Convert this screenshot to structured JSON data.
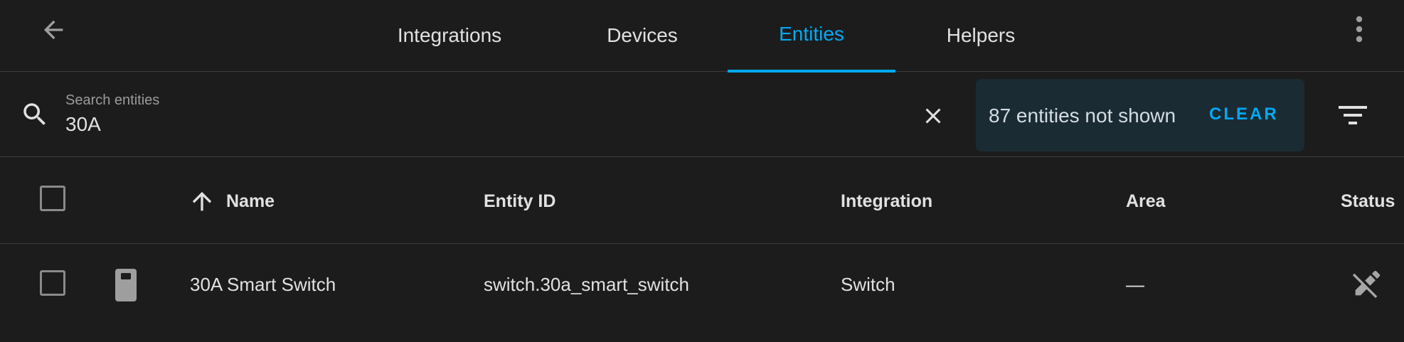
{
  "toolbar": {
    "tabs": [
      {
        "label": "Integrations",
        "active": false
      },
      {
        "label": "Devices",
        "active": false
      },
      {
        "label": "Entities",
        "active": true
      },
      {
        "label": "Helpers",
        "active": false
      }
    ],
    "accent_color": "#03a9f4"
  },
  "search": {
    "placeholder": "Search entities",
    "value": "30A"
  },
  "filter_banner": {
    "text": "87 entities not shown",
    "clear_label": "CLEAR"
  },
  "table": {
    "sort": {
      "column": "Name",
      "direction": "ascending"
    },
    "columns": [
      "Name",
      "Entity ID",
      "Integration",
      "Area",
      "Status"
    ],
    "rows": [
      {
        "icon": "switch-icon",
        "name": "30A Smart Switch",
        "entity_id": "switch.30a_smart_switch",
        "integration": "Switch",
        "area": "—",
        "status_icon": "pencil-off-icon"
      }
    ]
  }
}
